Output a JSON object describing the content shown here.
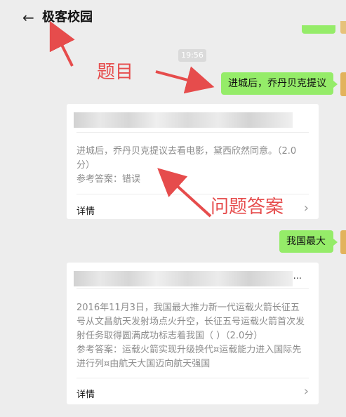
{
  "header": {
    "back_icon": "arrow-left-icon",
    "title": "极客校园"
  },
  "timestamp": "19:56",
  "messages": [
    {
      "text": "进城后，乔丹贝克提议"
    },
    {
      "text": "我国最大"
    }
  ],
  "cards": [
    {
      "question": "进城后，乔丹贝克提议去看电影，黛西欣然同意。（2.0分）",
      "answer": "参考答案：错误",
      "detail_label": "详情"
    },
    {
      "question": "2016年11月3日，我国最大推力新一代运载火箭长征五号从文昌航天发射场点火升空，长征五号运载火箭首次发射任务取得圆满成功标志着我国（ ）（2.0分）",
      "answer": "参考答案：运载火箭实现升级换代¤运载能力进入国际先进行列¤由航天大国迈向航天强国",
      "detail_label": "详情",
      "more": "..."
    }
  ],
  "annotations": {
    "question_label": "题目",
    "answer_label": "问题答案",
    "color": "#e64c4c"
  }
}
